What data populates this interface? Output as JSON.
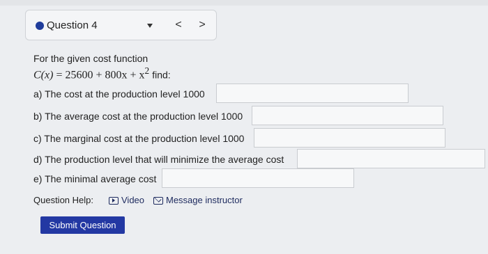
{
  "question": {
    "title": "Question 4",
    "prev_label": "<",
    "next_label": ">"
  },
  "problem": {
    "intro": "For the given cost function",
    "formula_lhs": "C(x)",
    "formula_eq": "= 25600 + 800x + x",
    "formula_exp": "2",
    "formula_suffix": "find:"
  },
  "parts": [
    {
      "label": "a) The cost at the production level 1000",
      "value": ""
    },
    {
      "label": "b) The average cost at the production level 1000",
      "value": ""
    },
    {
      "label": "c) The marginal cost at the production level 1000",
      "value": ""
    },
    {
      "label": "d) The production level that will minimize the average cost",
      "value": ""
    },
    {
      "label": "e) The minimal average cost",
      "value": ""
    }
  ],
  "help": {
    "label": "Question Help:",
    "video_label": "Video",
    "message_label": "Message instructor"
  },
  "submit_label": "Submit Question"
}
